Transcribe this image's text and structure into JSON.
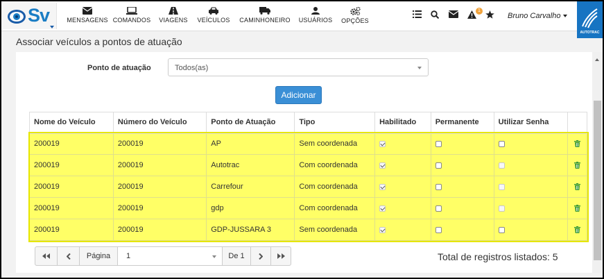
{
  "nav": {
    "logo_text": "Sv",
    "items": [
      {
        "label": "MENSAGENS",
        "icon": "envelope-icon"
      },
      {
        "label": "COMANDOS",
        "icon": "laptop-icon"
      },
      {
        "label": "VIAGENS",
        "icon": "road-icon"
      },
      {
        "label": "VEÍCULOS",
        "icon": "car-icon"
      },
      {
        "label": "CAMINHONEIRO",
        "icon": "truck-icon"
      },
      {
        "label": "USUÁRIOS",
        "icon": "user-icon"
      },
      {
        "label": "OPÇÕES",
        "icon": "cogs-icon"
      }
    ],
    "alert_badge": "1",
    "user_name": "Bruno Carvalho",
    "brand_text": "AUTOTRAC"
  },
  "page": {
    "title": "Associar veículos a pontos de atuação"
  },
  "filter": {
    "label": "Ponto de atuação",
    "value": "Todos(as)"
  },
  "add_button": "Adicionar",
  "table": {
    "headers": [
      "Nome do Veículo",
      "Número do Veículo",
      "Ponto de Atuação",
      "Tipo",
      "Habilitado",
      "Permanente",
      "Utilizar Senha",
      ""
    ],
    "rows": [
      {
        "nome": "200019",
        "numero": "200019",
        "ponto": "AP",
        "tipo": "Sem coordenada",
        "habilitado": true,
        "permanente": false,
        "senha": false,
        "senha_enabled": true
      },
      {
        "nome": "200019",
        "numero": "200019",
        "ponto": "Autotrac",
        "tipo": "Com coordenada",
        "habilitado": true,
        "permanente": false,
        "senha": false,
        "senha_enabled": false
      },
      {
        "nome": "200019",
        "numero": "200019",
        "ponto": "Carrefour",
        "tipo": "Com coordenada",
        "habilitado": true,
        "permanente": false,
        "senha": false,
        "senha_enabled": false
      },
      {
        "nome": "200019",
        "numero": "200019",
        "ponto": "gdp",
        "tipo": "Com coordenada",
        "habilitado": true,
        "permanente": false,
        "senha": false,
        "senha_enabled": false
      },
      {
        "nome": "200019",
        "numero": "200019",
        "ponto": "GDP-JUSSARA 3",
        "tipo": "Sem coordenada",
        "habilitado": true,
        "permanente": false,
        "senha": false,
        "senha_enabled": true
      }
    ]
  },
  "pager": {
    "page_label": "Página",
    "page_value": "1",
    "of_label": "De 1"
  },
  "total_text": "Total de registros listados: 5",
  "colors": {
    "highlight": "#ffff66",
    "brand_blue": "#1774c2",
    "button_blue": "#3a8fd6",
    "trash_green": "#3a9a3a"
  }
}
